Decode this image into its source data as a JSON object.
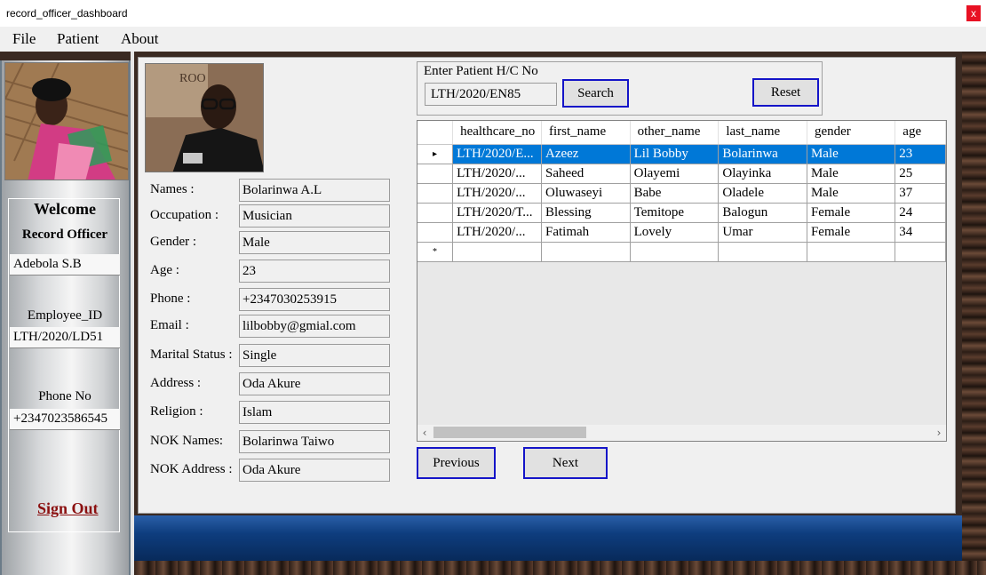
{
  "window": {
    "title": "record_officer_dashboard",
    "close_glyph": "x"
  },
  "menu": {
    "file": "File",
    "patient": "Patient",
    "about": "About"
  },
  "sidebar": {
    "welcome": "Welcome",
    "role": "Record Officer",
    "officer_name": "Adebola S.B",
    "employee_id_label": "Employee_ID",
    "employee_id": "LTH/2020/LD51",
    "phone_label": "Phone No",
    "phone": "+2347023586545",
    "sign_out": "Sign Out"
  },
  "profile": {
    "fields": [
      {
        "label": "Names :",
        "value": "Bolarinwa A.L"
      },
      {
        "label": "Occupation :",
        "value": "Musician"
      },
      {
        "label": "Gender :",
        "value": "Male"
      },
      {
        "label": "Age :",
        "value": "23"
      },
      {
        "label": "Phone :",
        "value": "+2347030253915"
      },
      {
        "label": "Email :",
        "value": "lilbobby@gmial.com"
      },
      {
        "label": "Marital Status :",
        "value": "Single"
      },
      {
        "label": "Address :",
        "value": "Oda Akure"
      },
      {
        "label": "Religion :",
        "value": "Islam"
      },
      {
        "label": "NOK Names:",
        "value": "Bolarinwa Taiwo"
      },
      {
        "label": "NOK Address :",
        "value": "Oda Akure"
      }
    ]
  },
  "search": {
    "label": "Enter Patient H/C No",
    "value": "LTH/2020/EN85",
    "search_button": "Search",
    "reset_button": "Reset"
  },
  "grid": {
    "columns": [
      "healthcare_no",
      "first_name",
      "other_name",
      "last_name",
      "gender",
      "age"
    ],
    "rows": [
      [
        "LTH/2020/E...",
        "Azeez",
        "Lil Bobby",
        "Bolarinwa",
        "Male",
        "23"
      ],
      [
        "LTH/2020/...",
        "Saheed",
        "Olayemi",
        "Olayinka",
        "Male",
        "25"
      ],
      [
        "LTH/2020/...",
        "Oluwaseyi",
        "Babe",
        "Oladele",
        "Male",
        "37"
      ],
      [
        "LTH/2020/T...",
        "Blessing",
        "Temitope",
        "Balogun",
        "Female",
        "24"
      ],
      [
        "LTH/2020/...",
        "Fatimah",
        "Lovely",
        "Umar",
        "Female",
        "34"
      ]
    ],
    "current_row_marker": "▸",
    "new_row_marker": "*",
    "selected_row": 0
  },
  "pager": {
    "previous": "Previous",
    "next": "Next"
  },
  "colors": {
    "accent": "#0078d7",
    "button_border": "#1414c8",
    "sign_out": "#8b1010",
    "strip": "#0e3d7e"
  }
}
